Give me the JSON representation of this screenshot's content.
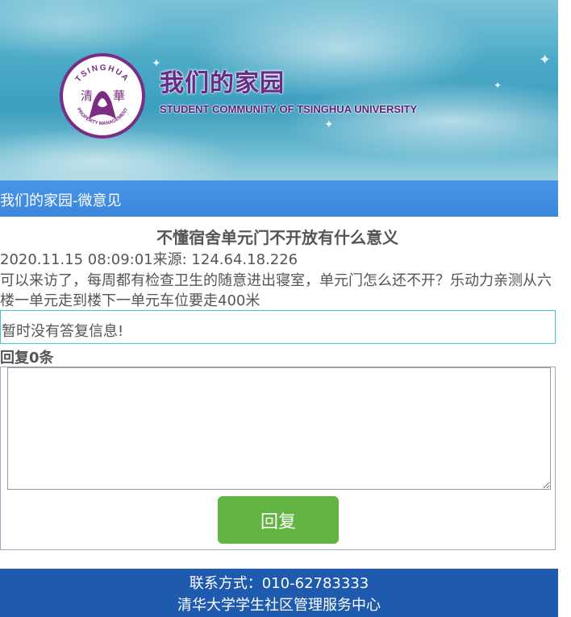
{
  "header": {
    "site_title": "我们的家园",
    "site_subtitle": "STUDENT COMMUNITY OF TSINGHUA UNIVERSITY",
    "logo": {
      "top_text": "TSINGHUA",
      "bottom_text": "PROPERTY MANAGEMENT",
      "left_char": "清",
      "right_char": "華",
      "icon": "lotus-emblem-icon"
    }
  },
  "nav": {
    "title": "我们的家园-微意见"
  },
  "post": {
    "title": "不懂宿舍单元门不开放有什么意义",
    "meta": "2020.11.15 08:09:01来源: 124.64.18.226",
    "body": "可以来访了，每周都有检查卫生的随意进出寝室，单元门怎么还不开？乐动力亲测从六楼一单元走到楼下一单元车位要走400米"
  },
  "reply_info": {
    "text": "暂时没有答复信息!"
  },
  "replies": {
    "count_label": "回复0条",
    "textarea_value": "",
    "submit_label": "回复"
  },
  "footer": {
    "contact": "联系方式：010-62783333",
    "organization": "清华大学学生社区管理服务中心"
  },
  "colors": {
    "nav_bar": "#3a86db",
    "reply_button": "#62b543",
    "footer": "#1e5aae",
    "brand_purple": "#6a2a86"
  }
}
